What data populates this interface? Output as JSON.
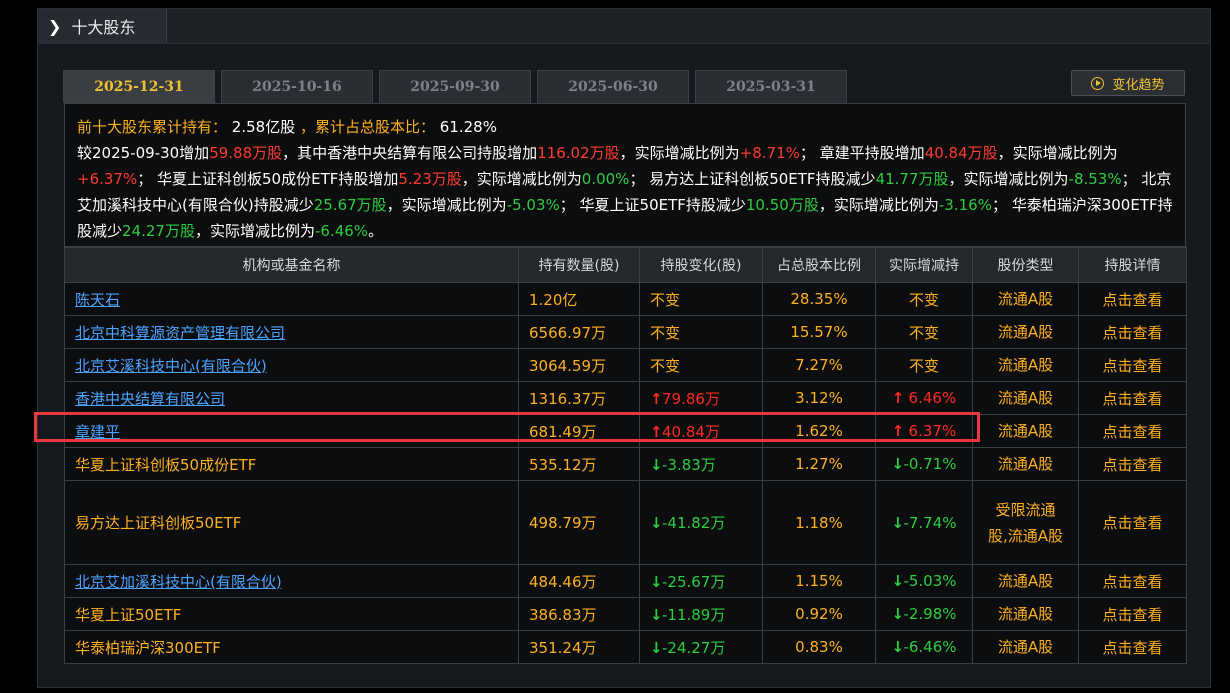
{
  "header": {
    "title": "十大股东"
  },
  "tabs": [
    "2025-12-31",
    "2025-10-16",
    "2025-09-30",
    "2025-06-30",
    "2025-03-31"
  ],
  "trend_button": "变化趋势",
  "summary": {
    "line1_label": "前十大股东累计持有：",
    "line1_value": "2.58亿股",
    "line1_label2": "，累计占总股本比：",
    "line1_value2": "61.28%",
    "p1": "较2025-09-30增加",
    "p1v": "59.88万股",
    "p2": "，其中香港中央结算有限公司持股增加",
    "p2v": "116.02万股",
    "p3": "，实际增减比例为",
    "p3v": "+8.71%",
    "p4": "；  章建平持股增加",
    "p4v": "40.84万股",
    "p5": "，实际增减比例为",
    "p5v": "+6.37%",
    "p6": "；  华夏上证科创板50成份ETF持股增加",
    "p6v": "5.23万股",
    "p7": "，实际增减比例为",
    "p7v": "0.00%",
    "p8": "；  易方达上证科创板50ETF持股减少",
    "p8v": "41.77万股",
    "p9": "，实际增减比例为",
    "p9v": "-8.53%",
    "p10": "；  北京艾加溪科技中心(有限合伙)持股减少",
    "p10v": "25.67万股",
    "p11": "，实际增减比例为",
    "p11v": "-5.03%",
    "p12": "；  华夏上证50ETF持股减少",
    "p12v": "10.50万股",
    "p13": "，实际增减比例为",
    "p13v": "-3.16%",
    "p14": "；  华泰柏瑞沪深300ETF持股减少",
    "p14v": "24.27万股",
    "p15": "，实际增减比例为",
    "p15v": "-6.46%",
    "p16": "。"
  },
  "table": {
    "columns": [
      "机构或基金名称",
      "持有数量(股)",
      "持股变化(股)",
      "占总股本比例",
      "实际增减持",
      "股份类型",
      "持股详情"
    ],
    "rows": [
      {
        "name": "陈天石",
        "link": true,
        "qty": "1.20亿",
        "chg": "不变",
        "chg_dir": "flat",
        "pct": "28.35%",
        "real": "不变",
        "real_dir": "flat",
        "type": "流通A股",
        "detail": "点击查看"
      },
      {
        "name": "北京中科算源资产管理有限公司",
        "link": true,
        "qty": "6566.97万",
        "chg": "不变",
        "chg_dir": "flat",
        "pct": "15.57%",
        "real": "不变",
        "real_dir": "flat",
        "type": "流通A股",
        "detail": "点击查看"
      },
      {
        "name": "北京艾溪科技中心(有限合伙)",
        "link": true,
        "qty": "3064.59万",
        "chg": "不变",
        "chg_dir": "flat",
        "pct": "7.27%",
        "real": "不变",
        "real_dir": "flat",
        "type": "流通A股",
        "detail": "点击查看"
      },
      {
        "name": "香港中央结算有限公司",
        "link": true,
        "qty": "1316.37万",
        "chg": "79.86万",
        "chg_dir": "up",
        "pct": "3.12%",
        "real": " 6.46%",
        "real_dir": "up",
        "type": "流通A股",
        "detail": "点击查看"
      },
      {
        "name": "章建平",
        "link": true,
        "qty": "681.49万",
        "chg": "40.84万",
        "chg_dir": "up",
        "pct": "1.62%",
        "real": " 6.37%",
        "real_dir": "up",
        "type": "流通A股",
        "detail": "点击查看"
      },
      {
        "name": "华夏上证科创板50成份ETF",
        "link": false,
        "qty": "535.12万",
        "chg": "-3.83万",
        "chg_dir": "down",
        "pct": "1.27%",
        "real": "-0.71%",
        "real_dir": "down",
        "type": "流通A股",
        "detail": "点击查看"
      },
      {
        "name": "易方达上证科创板50ETF",
        "link": false,
        "qty": "498.79万",
        "chg": "-41.82万",
        "chg_dir": "down",
        "pct": "1.18%",
        "real": "-7.74%",
        "real_dir": "down",
        "type": "受限流通股,流通A股",
        "detail": "点击查看",
        "tall": true
      },
      {
        "name": "北京艾加溪科技中心(有限合伙)",
        "link": true,
        "qty": "484.46万",
        "chg": "-25.67万",
        "chg_dir": "down",
        "pct": "1.15%",
        "real": "-5.03%",
        "real_dir": "down",
        "type": "流通A股",
        "detail": "点击查看"
      },
      {
        "name": "华夏上证50ETF",
        "link": false,
        "qty": "386.83万",
        "chg": "-11.89万",
        "chg_dir": "down",
        "pct": "0.92%",
        "real": "-2.98%",
        "real_dir": "down",
        "type": "流通A股",
        "detail": "点击查看"
      },
      {
        "name": "华泰柏瑞沪深300ETF",
        "link": false,
        "qty": "351.24万",
        "chg": "-24.27万",
        "chg_dir": "down",
        "pct": "0.83%",
        "real": "-6.46%",
        "real_dir": "down",
        "type": "流通A股",
        "detail": "点击查看"
      }
    ]
  },
  "colors": {
    "accent": "#f0c232",
    "up": "#ff2a20",
    "down": "#2ecc40",
    "link": "#4ea3ff",
    "value": "#ffb020",
    "highlight": "#e8383d"
  },
  "icons": {
    "up": "arrow-up-icon",
    "down": "arrow-down-icon",
    "header": "chevron-right-icon",
    "trend": "play-circle-icon"
  }
}
